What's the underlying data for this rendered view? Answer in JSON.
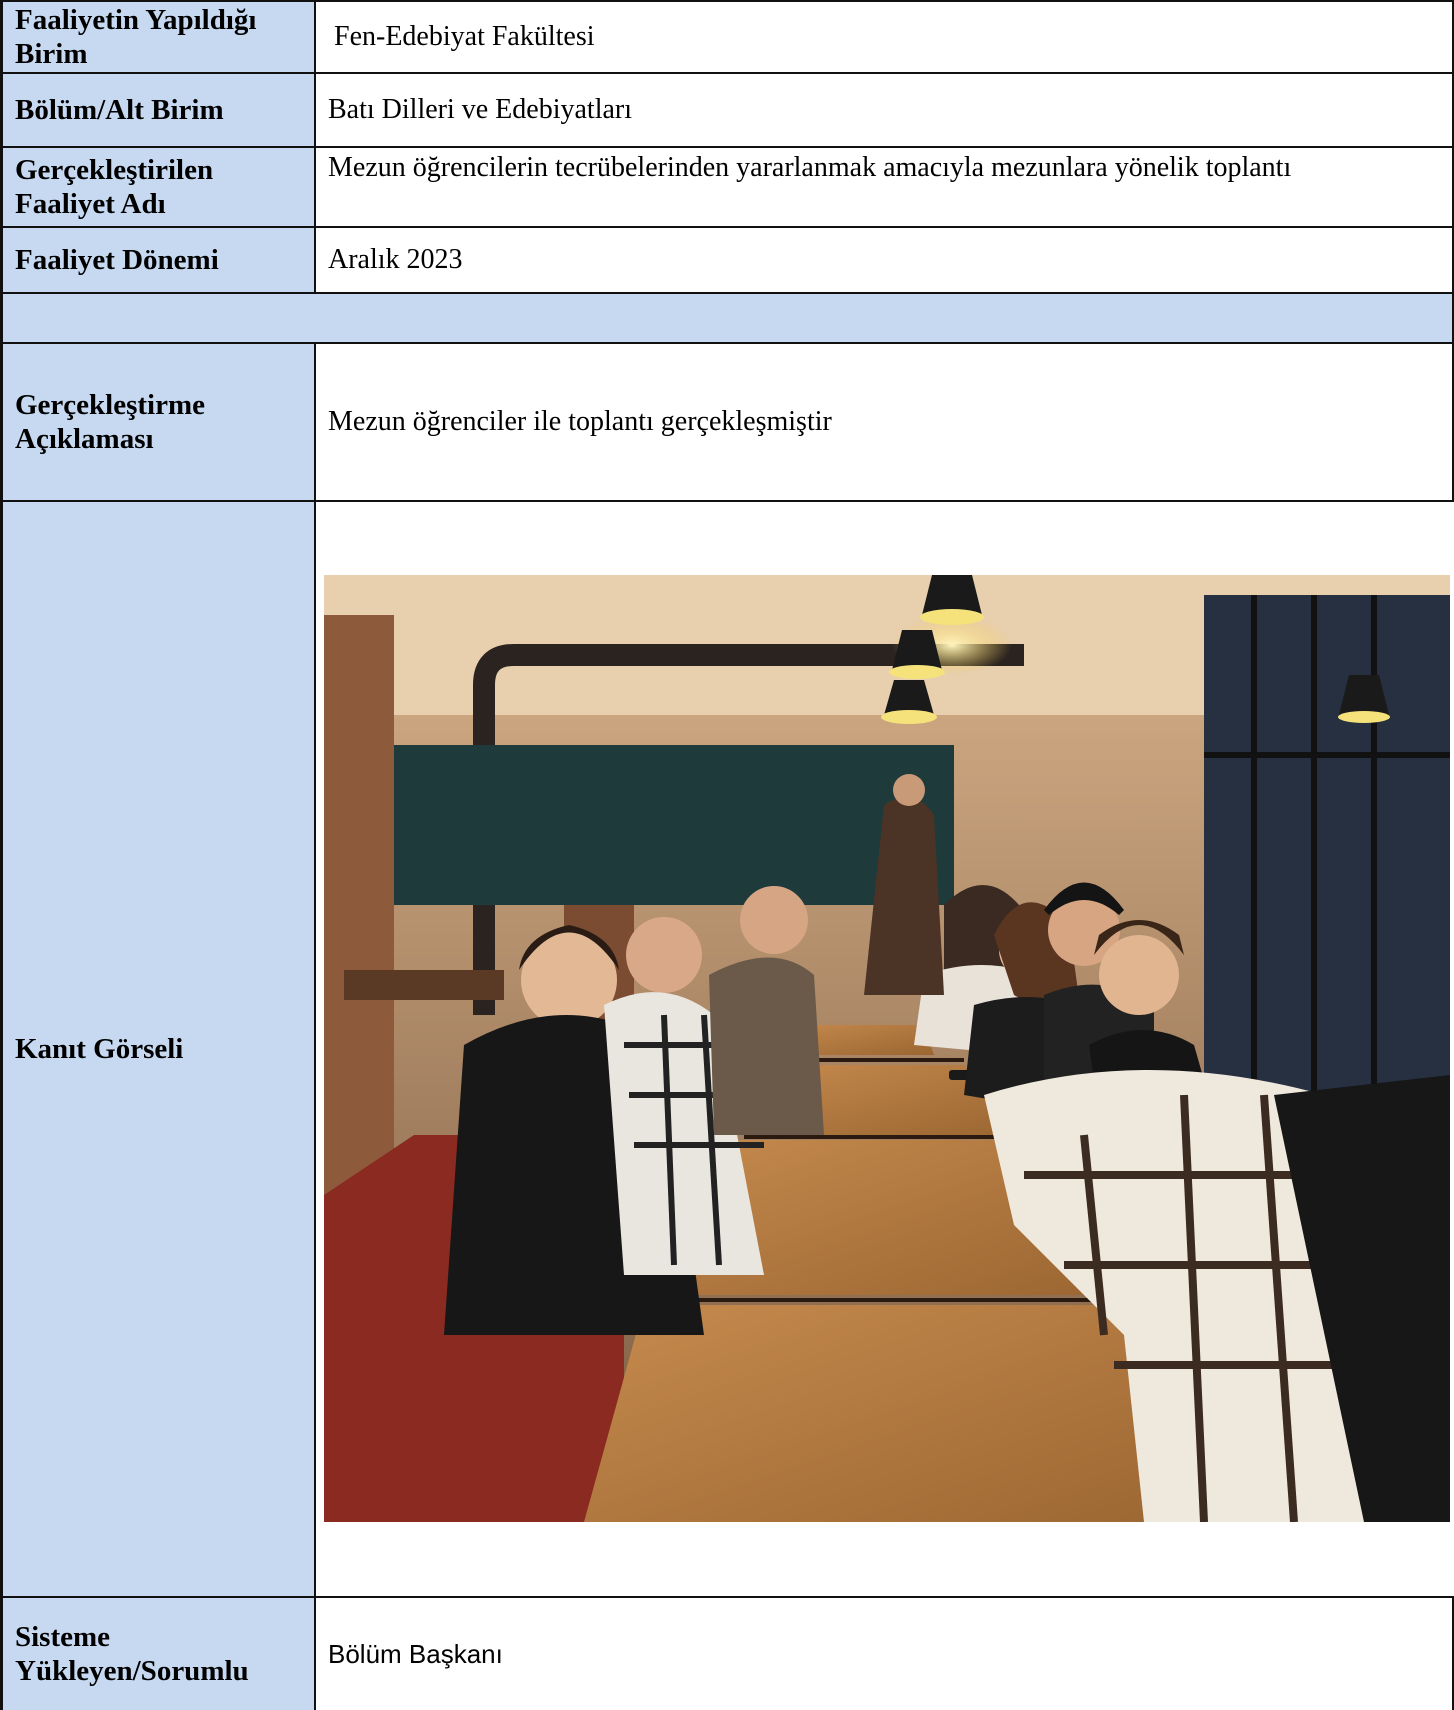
{
  "rows": {
    "birim_label": "Faaliyetin Yapıldığı Birim",
    "birim_value": "Fen-Edebiyat Fakültesi",
    "bolum_label": "Bölüm/Alt Birim",
    "bolum_value": "Batı Dilleri ve Edebiyatları",
    "faaliyet_label": "Gerçekleştirilen Faaliyet Adı",
    "faaliyet_value": "Mezun öğrencilerin tecrübelerinden yararlanmak amacıyla mezunlara yönelik toplantı",
    "donem_label": "Faaliyet Dönemi",
    "donem_value": "Aralık 2023",
    "aciklama_label": "Gerçekleştirme Açıklaması",
    "aciklama_value": "Mezun öğrenciler ile toplantı gerçekleşmiştir",
    "kanit_label": "Kanıt Görseli",
    "sorumlu_label": "Sisteme Yükleyen/Sorumlu",
    "sorumlu_value": "Bölüm Başkanı"
  },
  "colors": {
    "label_bg": "#c6d9f1",
    "border": "#111111"
  }
}
